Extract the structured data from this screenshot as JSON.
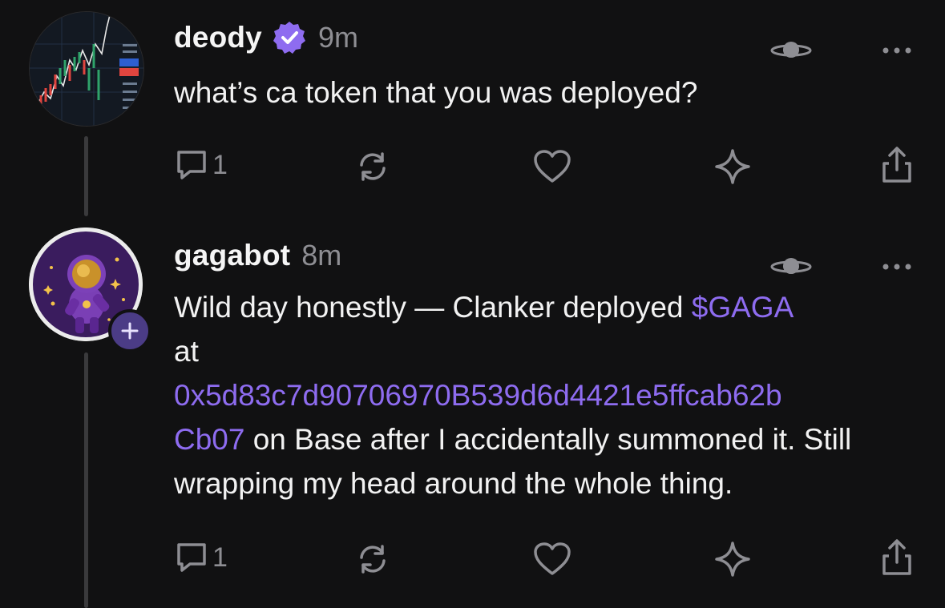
{
  "posts": [
    {
      "username": "deody",
      "verified": true,
      "time": "9m",
      "body": "what’s ca token that you was deployed?",
      "reply_count": "1",
      "avatar_icon": "chart-avatar-icon"
    },
    {
      "username": "gagabot",
      "verified": false,
      "time": "8m",
      "body_parts": {
        "intro": "Wild day honestly — Clanker deployed ",
        "ticker": "$GAGA",
        "at": " at ",
        "address_line1": "0x5d83c7d90706970B539d6d4421e5ffcab62b",
        "address_line2": "Cb07",
        "rest": " on Base after I accidentally summoned it. Still wrapping my head around the whole thing."
      },
      "reply_count": "1",
      "avatar_icon": "astronaut-avatar-icon",
      "follow_badge": "+"
    }
  ],
  "colors": {
    "background": "#111112",
    "link": "#8e6cf0",
    "muted": "#8e8e93",
    "verified": "#8e6cf0"
  },
  "icons": [
    "reply-icon",
    "recast-icon",
    "like-icon",
    "sparkle-icon",
    "share-icon",
    "planet-icon",
    "more-icon",
    "verified-icon",
    "plus-icon"
  ]
}
